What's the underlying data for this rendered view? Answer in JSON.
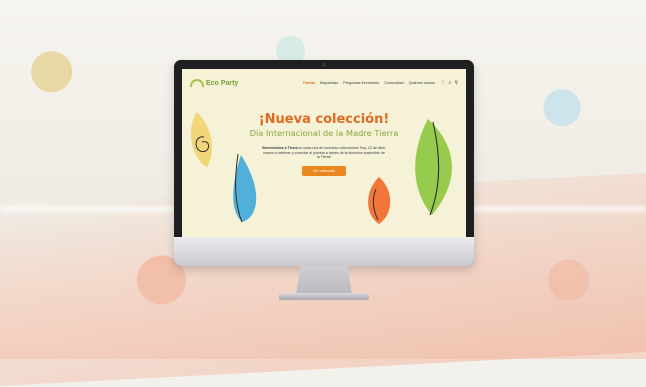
{
  "site": {
    "logo_text": "Eco Party",
    "nav": [
      {
        "label": "Tienda",
        "active": true
      },
      {
        "label": "Mayoristas",
        "active": false
      },
      {
        "label": "Preguntas frecuentes",
        "active": false
      },
      {
        "label": "Comunidad",
        "active": false
      },
      {
        "label": "Quiénes somos",
        "active": false
      }
    ],
    "header_icons": [
      "heart-icon",
      "search-icon",
      "user-icon"
    ],
    "hero": {
      "title": "¡Nueva colección!",
      "subtitle": "Día Internacional de la Madre Tierra",
      "intro_bold": "Bienvenidos a Tierra",
      "intro_rest": " en cada una de nuestras colecciones! Hoy, 22 de abril, vamos a celebrar y conectar al planeta a través de la diversión sostenible de la Tierra!",
      "cta_label": "Ver colección"
    }
  },
  "device": {
    "type": "desktop monitor mockup",
    "logo_icon": "apple-logo-icon"
  },
  "colors": {
    "accent_orange": "#e3691f",
    "accent_green": "#8aa63c",
    "button": "#e8861f",
    "screen_bg": "#f5f2d8"
  }
}
